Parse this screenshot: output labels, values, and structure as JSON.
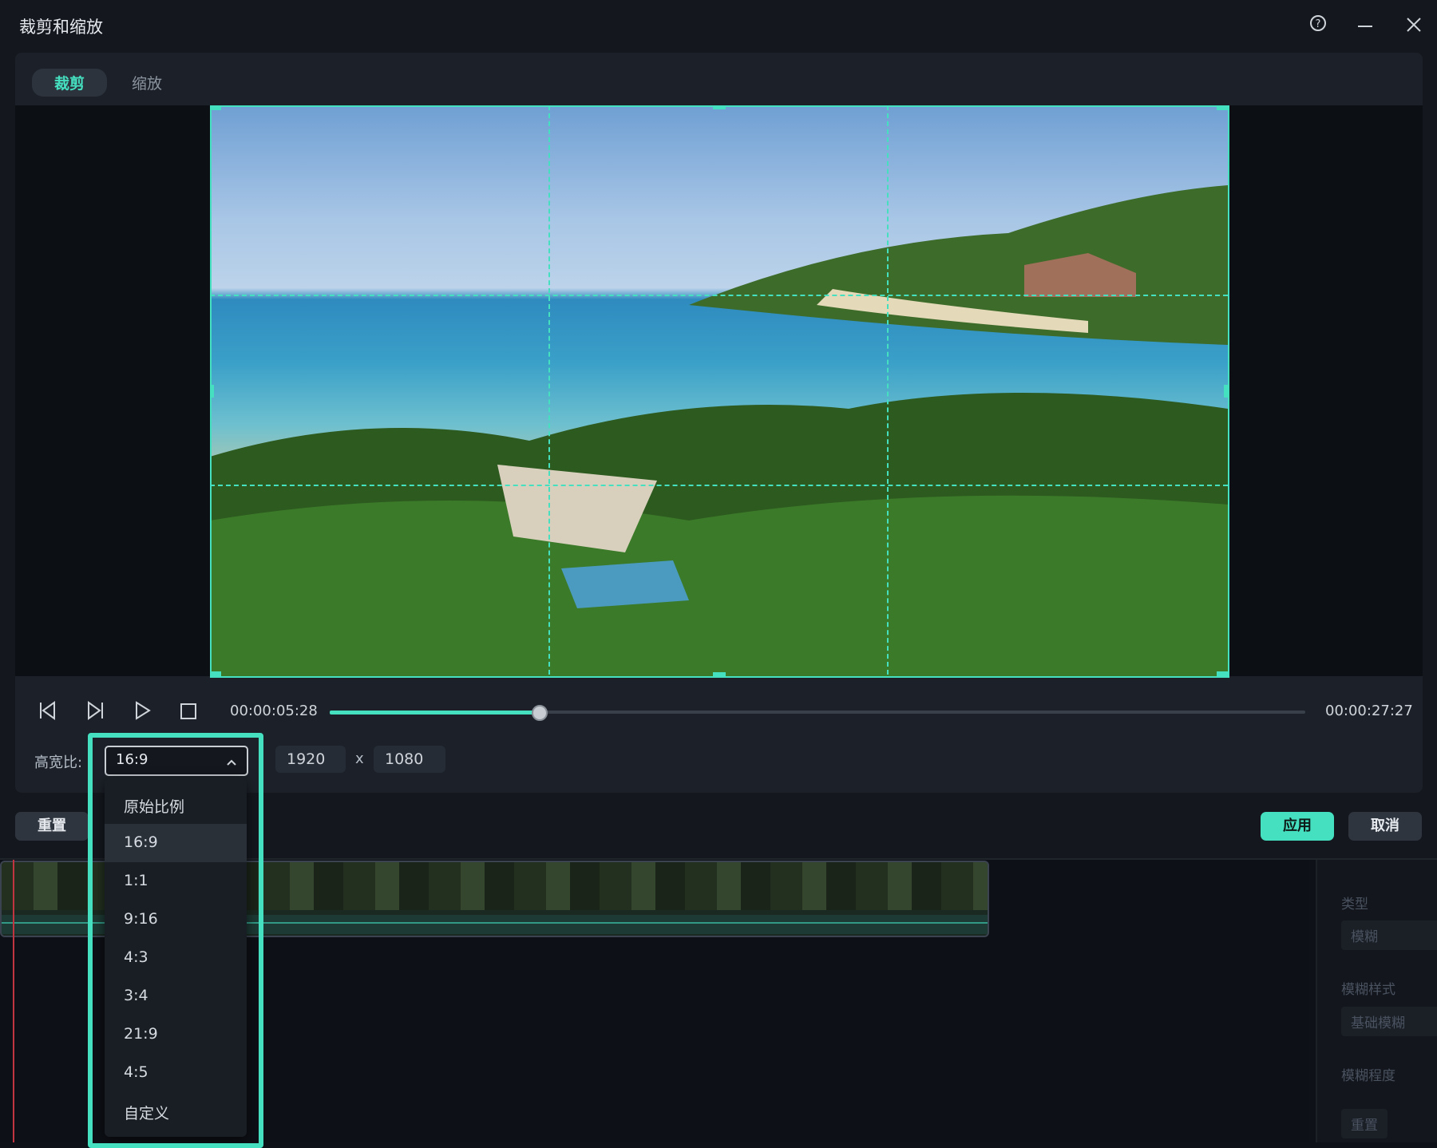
{
  "dialog": {
    "title": "裁剪和缩放",
    "help_icon": "help-circle-icon",
    "minimize_icon": "minimize-icon",
    "close_icon": "close-icon"
  },
  "tabs": [
    {
      "label": "裁剪",
      "active": true
    },
    {
      "label": "缩放",
      "active": false
    }
  ],
  "player": {
    "current_time": "00:00:05:28",
    "total_time": "00:00:27:27",
    "progress": 0.216,
    "icons": [
      "prev-frame-icon",
      "next-frame-icon",
      "play-icon",
      "stop-icon"
    ]
  },
  "aspect": {
    "label": "高宽比:",
    "selected": "16:9",
    "width": "1920",
    "times": "x",
    "height": "1080",
    "options": [
      "原始比例",
      "16:9",
      "1:1",
      "9:16",
      "4:3",
      "3:4",
      "21:9",
      "4:5",
      "自定义"
    ]
  },
  "buttons": {
    "reset": "重置",
    "apply": "应用",
    "cancel": "取消"
  },
  "background_panel": {
    "type_label": "类型",
    "type_value": "模糊",
    "blur_style_label": "模糊样式",
    "blur_style_value": "基础模糊",
    "blur_level_label": "模糊程度",
    "reset": "重置"
  },
  "colors": {
    "accent": "#45e0c0",
    "background": "#14181e"
  }
}
